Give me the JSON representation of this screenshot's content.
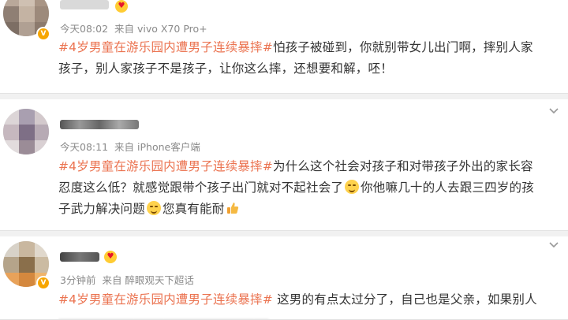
{
  "comments": [
    {
      "time": "今天08:02",
      "source": "来自 vivo X70 Pro+",
      "hashtag": "#4岁男童在游乐园内遭男子连续暴摔#",
      "line1_rest": "怕孩子被碰到，你就别带女儿出门啊，摔别人家",
      "line2": "孩子，别人家孩子不是孩子，让你这么摔，还想要和解，呸！"
    },
    {
      "time": "今天08:11",
      "source": "来自 iPhone客户端",
      "hashtag": "#4岁男童在游乐园内遭男子连续暴摔#",
      "line1_rest": "为什么这个社会对孩子和对带孩子外出的家长容",
      "line2_a": "忍度这么低？就感觉跟带个孩子出门就对不起社会了",
      "line2_b": "你他嘛几十的人去跟三四岁的孩",
      "line3_a": "子武力解决问题",
      "line3_b": "您真有能耐"
    },
    {
      "time": "3分钟前",
      "source": "来自 醉眼观天下超话",
      "hashtag": "#4岁男童在游乐园内遭男子连续暴摔#",
      "line1_rest": " 这男的有点太过分了，自己也是父亲，如果别人"
    }
  ],
  "icons": {
    "badge": "vip-badge-icon",
    "chevron": "chevron-down-icon",
    "emoji": "smile-emoji-icon",
    "thumb": "thumbs-up-icon"
  },
  "colors": {
    "hashtag": "#eb7350",
    "meta": "#8a8a8a",
    "badge": "#f7a600"
  }
}
